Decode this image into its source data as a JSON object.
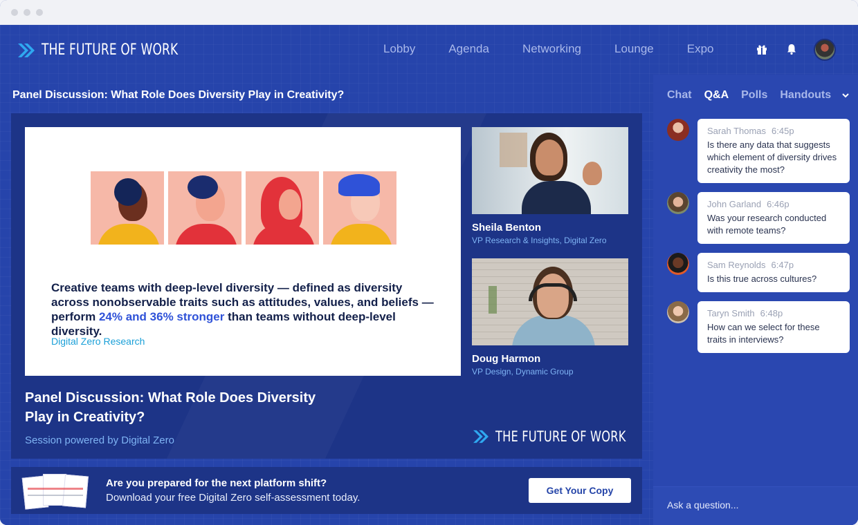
{
  "header": {
    "logo_text": "THE FUTURE OF WORK",
    "nav": [
      "Lobby",
      "Agenda",
      "Networking",
      "Lounge",
      "Expo"
    ],
    "icons": [
      "gift-icon",
      "bell-icon",
      "user-avatar"
    ]
  },
  "session": {
    "title": "Panel Discussion: What Role Does Diversity Play in Creativity?"
  },
  "slide": {
    "quote_before": "Creative teams with deep-level diversity — defined as diversity across nonobservable traits such as attitudes, values, and beliefs — perform ",
    "quote_highlight": "24% and 36% stronger",
    "quote_after": " than teams without deep-level diversity.",
    "source": "Digital Zero Research"
  },
  "speakers": [
    {
      "name": "Sheila Benton",
      "role": "VP Research & Insights, Digital Zero"
    },
    {
      "name": "Doug Harmon",
      "role": "VP Design, Dynamic Group"
    }
  ],
  "stage": {
    "title": "Panel Discussion: What Role Does Diversity Play in Creativity?",
    "powered_by": "Session powered by Digital Zero",
    "logo_text": "THE FUTURE OF WORK"
  },
  "promo": {
    "title": "Are you prepared for the next platform shift?",
    "subtitle": "Download your free Digital Zero self-assessment today.",
    "button": "Get Your Copy"
  },
  "panel": {
    "tabs": [
      "Chat",
      "Q&A",
      "Polls",
      "Handouts"
    ],
    "active_tab": "Q&A",
    "messages": [
      {
        "name": "Sarah Thomas",
        "time": "6:45p",
        "text": "Is there any data that suggests which element of diversity drives creativity the most?"
      },
      {
        "name": "John Garland",
        "time": "6:46p",
        "text": "Was your research conducted with remote teams?"
      },
      {
        "name": "Sam Reynolds",
        "time": "6:47p",
        "text": "Is this true across cultures?"
      },
      {
        "name": "Taryn Smith",
        "time": "6:48p",
        "text": "How can we select for these traits in interviews?"
      }
    ],
    "ask_placeholder": "Ask a question..."
  },
  "colors": {
    "background": "#2644ab",
    "stage": "#1d3487",
    "accent_light_blue": "#7fb4f4",
    "logo_chevron": "#2fa8f0",
    "highlight": "#2f52d8"
  }
}
